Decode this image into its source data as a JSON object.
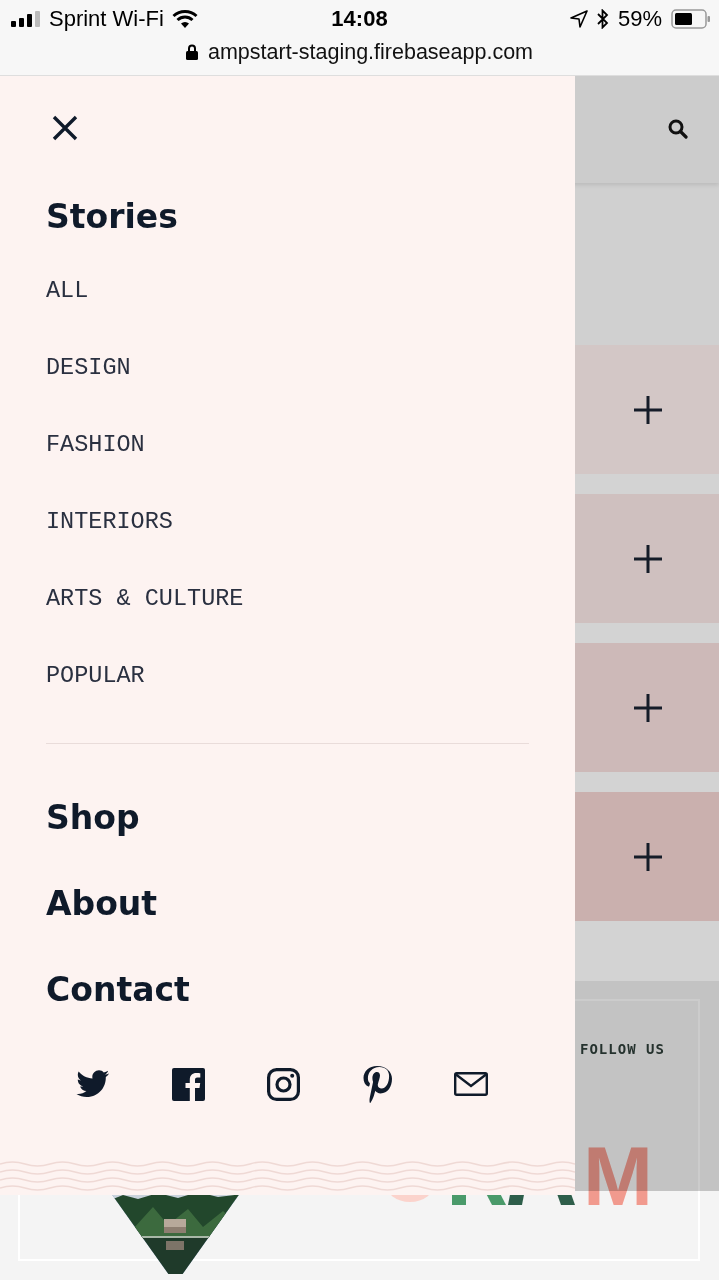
{
  "status_bar": {
    "carrier": "Sprint Wi-Fi",
    "time": "14:08",
    "battery": "59%",
    "url": "ampstart-staging.firebaseapp.com"
  },
  "menu": {
    "section_title": "Stories",
    "categories": [
      "ALL",
      "DESIGN",
      "FASHION",
      "INTERIORS",
      "ARTS & CULTURE",
      "POPULAR"
    ],
    "pages": [
      "Shop",
      "About",
      "Contact"
    ],
    "social": [
      {
        "kind": "twitter"
      },
      {
        "kind": "facebook"
      },
      {
        "kind": "instagram"
      },
      {
        "kind": "pinterest"
      },
      {
        "kind": "email"
      }
    ]
  },
  "page": {
    "cards": [
      {
        "color": "#d3c7c6"
      },
      {
        "color": "#cfc0bf"
      },
      {
        "color": "#cdb9b8"
      },
      {
        "color": "#cab0ae"
      }
    ],
    "follow_label": "FOLLOW US",
    "logo_letter": "M"
  }
}
